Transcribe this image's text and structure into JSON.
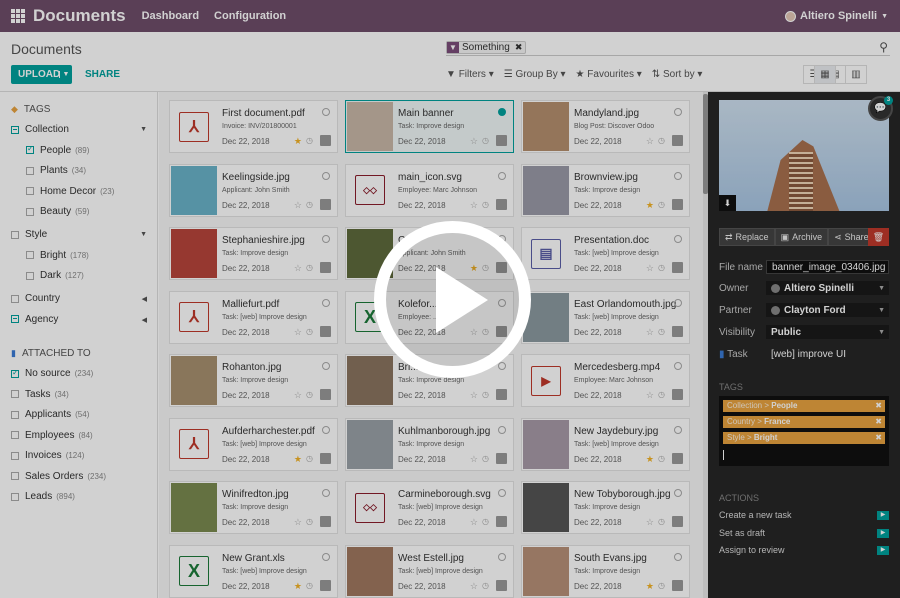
{
  "topbar": {
    "app": "Documents",
    "menus": [
      "Dashboard",
      "Configuration"
    ],
    "user": "Altiero Spinelli"
  },
  "control": {
    "title": "Documents",
    "facet": "Something",
    "upload": "UPLOAD",
    "share": "SHARE",
    "filters": [
      "Filters",
      "Group By",
      "Favourites",
      "Sort by"
    ]
  },
  "sidebar": {
    "tags_title": "TAGS",
    "tags": [
      {
        "label": "Collection",
        "count": "",
        "state": "minus",
        "level": 0
      },
      {
        "label": "People",
        "count": "(89)",
        "state": "chk",
        "level": 1
      },
      {
        "label": "Plants",
        "count": "(34)",
        "state": "",
        "level": 1
      },
      {
        "label": "Home Decor",
        "count": "(23)",
        "state": "",
        "level": 1
      },
      {
        "label": "Beauty",
        "count": "(59)",
        "state": "",
        "level": 1
      },
      {
        "label": "Style",
        "count": "",
        "state": "",
        "level": 0
      },
      {
        "label": "Bright",
        "count": "(178)",
        "state": "",
        "level": 1
      },
      {
        "label": "Dark",
        "count": "(127)",
        "state": "",
        "level": 1
      },
      {
        "label": "Country",
        "count": "",
        "state": "",
        "level": 0
      },
      {
        "label": "Agency",
        "count": "",
        "state": "minus",
        "level": 0
      }
    ],
    "attached_title": "ATTACHED TO",
    "attached": [
      {
        "label": "No source",
        "count": "(234)",
        "state": "chk"
      },
      {
        "label": "Tasks",
        "count": "(34)",
        "state": ""
      },
      {
        "label": "Applicants",
        "count": "(54)",
        "state": ""
      },
      {
        "label": "Employees",
        "count": "(84)",
        "state": ""
      },
      {
        "label": "Invoices",
        "count": "(124)",
        "state": ""
      },
      {
        "label": "Sales Orders",
        "count": "(234)",
        "state": ""
      },
      {
        "label": "Leads",
        "count": "(894)",
        "state": ""
      }
    ]
  },
  "cards": [
    {
      "name": "First document.pdf",
      "sub": "Invoice:  INV/201800001",
      "date": "Dec 22, 2018",
      "kind": "pdf",
      "star": true,
      "sel": false
    },
    {
      "name": "Main banner",
      "sub": "Task:  Improve design",
      "date": "Dec 22, 2018",
      "kind": "img",
      "color": "#c9b7a8",
      "star": false,
      "sel": true
    },
    {
      "name": "Mandyland.jpg",
      "sub": "Blog Post:  Discover Odoo",
      "date": "Dec 22, 2018",
      "kind": "img",
      "color": "#b58f6e",
      "star": false,
      "sel": false
    },
    {
      "name": "Keelingside.jpg",
      "sub": "Applicant:  John Smith",
      "date": "Dec 22, 2018",
      "kind": "img",
      "color": "#6ab3c8",
      "star": false,
      "sel": false
    },
    {
      "name": "main_icon.svg",
      "sub": "Employee:  Marc Johnson",
      "date": "Dec 22, 2018",
      "kind": "svg",
      "star": false,
      "sel": false
    },
    {
      "name": "Brownview.jpg",
      "sub": "Task:  Improve design",
      "date": "Dec 22, 2018",
      "kind": "img",
      "color": "#9a9aa8",
      "star": true,
      "sel": false
    },
    {
      "name": "Stephanieshire.jpg",
      "sub": "Task:  Improve design",
      "date": "Dec 22, 2018",
      "kind": "img",
      "color": "#b8453b",
      "star": false,
      "sel": false
    },
    {
      "name": "C...",
      "sub": "Applicant:  John Smith",
      "date": "Dec 22, 2018",
      "kind": "img",
      "color": "#5e6b3c",
      "star": true,
      "sel": false
    },
    {
      "name": "Presentation.doc",
      "sub": "Task:  [web] Improve design",
      "date": "Dec 22, 2018",
      "kind": "doc",
      "star": false,
      "sel": false
    },
    {
      "name": "Malliefurt.pdf",
      "sub": "Task:  [web] Improve design",
      "date": "Dec 22, 2018",
      "kind": "pdf",
      "star": false,
      "sel": false
    },
    {
      "name": "Kolefor...",
      "sub": "Employee:  ...",
      "date": "Dec 22, 2018",
      "kind": "xls",
      "star": false,
      "sel": false
    },
    {
      "name": "East Orlandomouth.jpg",
      "sub": "Task:  [web] Improve design",
      "date": "Dec 22, 2018",
      "kind": "img",
      "color": "#8b9aa0",
      "star": false,
      "sel": false
    },
    {
      "name": "Rohanton.jpg",
      "sub": "Task:  Improve design",
      "date": "Dec 22, 2018",
      "kind": "img",
      "color": "#a89070",
      "star": false,
      "sel": false
    },
    {
      "name": "Bri...",
      "sub": "Task:  Improve design",
      "date": "Dec 22, 2018",
      "kind": "img",
      "color": "#8a7560",
      "star": false,
      "sel": false
    },
    {
      "name": "Mercedesberg.mp4",
      "sub": "Employee:  Marc Johnson",
      "date": "Dec 22, 2018",
      "kind": "mp4",
      "star": false,
      "sel": false
    },
    {
      "name": "Aufderharchester.pdf",
      "sub": "Task:  [web] Improve design",
      "date": "Dec 22, 2018",
      "kind": "pdf",
      "star": true,
      "sel": false
    },
    {
      "name": "Kuhlmanborough.jpg",
      "sub": "Task:  Improve design",
      "date": "Dec 22, 2018",
      "kind": "img",
      "color": "#9aa2a8",
      "star": false,
      "sel": false
    },
    {
      "name": "New Jaydebury.jpg",
      "sub": "Task:  [web] Improve design",
      "date": "Dec 22, 2018",
      "kind": "img",
      "color": "#a89aa8",
      "star": true,
      "sel": false
    },
    {
      "name": "Winifredton.jpg",
      "sub": "Task:  Improve design",
      "date": "Dec 22, 2018",
      "kind": "img",
      "color": "#7a8a50",
      "star": false,
      "sel": false
    },
    {
      "name": "Carmineborough.svg",
      "sub": "Task:  [web] Improve design",
      "date": "Dec 22, 2018",
      "kind": "svg",
      "star": false,
      "sel": false
    },
    {
      "name": "New Tobyborough.jpg",
      "sub": "Task:  Improve design",
      "date": "Dec 22, 2018",
      "kind": "img",
      "color": "#555555",
      "star": false,
      "sel": false
    },
    {
      "name": "New Grant.xls",
      "sub": "Task:  [web] Improve design",
      "date": "Dec 22, 2018",
      "kind": "xls",
      "star": true,
      "sel": false
    },
    {
      "name": "West Estell.jpg",
      "sub": "Task:  [web] Improve design",
      "date": "Dec 22, 2018",
      "kind": "img",
      "color": "#a07860",
      "star": false,
      "sel": false
    },
    {
      "name": "South Evans.jpg",
      "sub": "Task:  Improve design",
      "date": "Dec 22, 2018",
      "kind": "img",
      "color": "#b89078",
      "star": true,
      "sel": false
    }
  ],
  "inspector": {
    "buttons": [
      "Replace",
      "Archive",
      "Share"
    ],
    "file_name_label": "File name",
    "file_name": "banner_image_03406.jpg",
    "owner_label": "Owner",
    "owner": "Altiero Spinelli",
    "partner_label": "Partner",
    "partner": "Clayton Ford",
    "visibility_label": "Visibility",
    "visibility": "Public",
    "task_label": "Task",
    "task": "[web] improve UI",
    "tags_title": "TAGS",
    "tags": [
      {
        "k": "Collection > ",
        "v": "People"
      },
      {
        "k": "Country > ",
        "v": "France"
      },
      {
        "k": "Style > ",
        "v": "Bright"
      }
    ],
    "actions_title": "ACTIONS",
    "actions": [
      "Create a new task",
      "Set as draft",
      "Assign to review"
    ],
    "chat_count": "3"
  },
  "colors": {
    "brand": "#6e4d6a",
    "accent": "#00a09d",
    "tag": "#e8a340",
    "star": "#f3b227"
  }
}
